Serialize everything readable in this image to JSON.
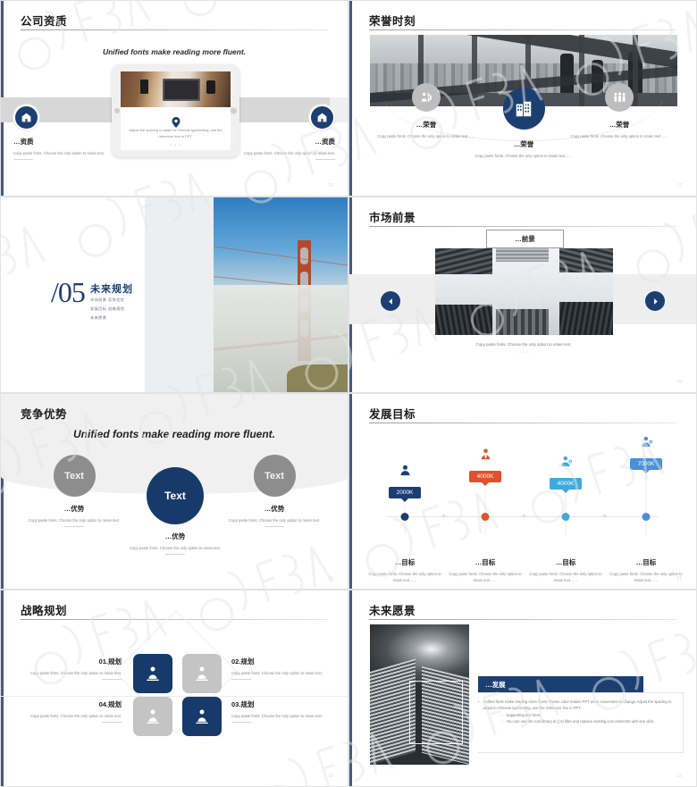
{
  "common": {
    "copy_line": "Copy paste fonts. Choose the only option to retain text.",
    "copy_line_dots": "Copy paste fonts. Choose the only option to retain text……",
    "dots_prefix": "…",
    "ellipsis": "……"
  },
  "slides": [
    {
      "id": "company-qualification",
      "title": "公司资质",
      "page": "15",
      "script": "Unified fonts make reading more fluent.",
      "tablet": {
        "caption": "Adjust the spacing to adapt to Chinese typesetting, use the reference line in PPT.",
        "dots": "• • •",
        "pin_icon": "location-pin-icon",
        "photo_alt": "desk-laptop-photo"
      },
      "columns": [
        {
          "icon": "home-shield-icon",
          "label": "…资质",
          "body": "Copy paste fonts. Choose the only option to retain text."
        },
        {
          "icon": "home-shield-icon",
          "label": "…资质",
          "body": "Copy paste fonts. Choose the only option to retain text."
        }
      ]
    },
    {
      "id": "honor-moment",
      "title": "荣誉时刻",
      "page": "17",
      "hero_alt": "people-looking-at-city-skyline-photo",
      "nodes": [
        {
          "icon": "person-award-icon",
          "label": "…荣誉",
          "body": "Copy paste fonts. Choose the only option to retain text……"
        },
        {
          "icon": "building-icon",
          "label": "…荣誉",
          "body": "Copy paste fonts. Choose the only option to retain text……"
        },
        {
          "icon": "people-group-icon",
          "label": "…荣誉",
          "body": "Copy paste fonts. Choose the only option to retain text……"
        }
      ]
    },
    {
      "id": "future-plan-divider",
      "number": "/05",
      "title": "未来规划",
      "sublines": [
        "市场前景   竞争优势",
        "发展目标   战略规划",
        "未来愿景"
      ],
      "image_alt": "golden-gate-bridge-photo"
    },
    {
      "id": "market-prospects",
      "title": "市场前景",
      "page": "19",
      "caption_box": "…前景",
      "image_alt": "skyscraper-looking-up-photo",
      "prev_icon": "arrow-left-icon",
      "next_icon": "arrow-right-icon",
      "body": "Copy paste fonts. Choose the only option to retain text.",
      "dots": "- - - -"
    },
    {
      "id": "competitive-advantage",
      "title": "竞争优势",
      "page": "20",
      "script": "Unified fonts make reading more fluent.",
      "nodes": [
        {
          "circle_text": "Text",
          "label": "…优势",
          "body": "Copy paste fonts. Choose the only option to retain text."
        },
        {
          "circle_text": "Text",
          "label": "…优势",
          "body": "Copy paste fonts. Choose the only option to retain text."
        },
        {
          "circle_text": "Text",
          "label": "…优势",
          "body": "Copy paste fonts. Choose the only option to retain text."
        }
      ]
    },
    {
      "id": "development-goals",
      "title": "发展目标",
      "page": "21",
      "milestones": [
        {
          "value": "2000K",
          "color": "#1b3f72",
          "icon": "person-dark-icon",
          "label": "…目标",
          "body": "Copy paste fonts. Choose the only option to retain text……"
        },
        {
          "value": "4000K",
          "color": "#e1512b",
          "icon": "person-tie-icon",
          "label": "…目标",
          "body": "Copy paste fonts. Choose the only option to retain text……"
        },
        {
          "value": "4000K",
          "color": "#3fa9dd",
          "icon": "person-cyan-icon",
          "label": "…目标",
          "body": "Copy paste fonts. Choose the only option to retain text……"
        },
        {
          "value": "7000K",
          "color": "#4a90d9",
          "icon": "person-blue-icon",
          "label": "…目标",
          "body": "Copy paste fonts. Choose the only option to retain text……"
        }
      ]
    },
    {
      "id": "strategic-planning",
      "title": "战略规划",
      "page": "22",
      "items": [
        {
          "label": "01.规划",
          "body": "Copy paste fonts. Choose the only option to retain text.",
          "tile": "blue",
          "icon": "organization-chart-icon"
        },
        {
          "label": "02.规划",
          "body": "Copy paste fonts. Choose the only option to retain text.",
          "tile": "grey",
          "icon": "organization-chart-icon"
        },
        {
          "label": "03.规划",
          "body": "Copy paste fonts. Choose the only option to retain text.",
          "tile": "blue",
          "icon": "organization-chart-icon"
        },
        {
          "label": "04.规划",
          "body": "Copy paste fonts. Choose the only option to retain text.",
          "tile": "grey",
          "icon": "organization-chart-icon"
        }
      ]
    },
    {
      "id": "future-vision",
      "title": "未来愿景",
      "page": "23",
      "image_alt": "skyscrapers-dark-sky-photo",
      "header_label": "…发展",
      "paragraph": "Unified fonts make reading more fluent.Theme color makes PPT more convenient to change.Adjust the spacing to adapt to Chinese typesetting, use the reference line in PPT.",
      "bullets": [
        "Supporting text here.",
        "You can use the icon library in  () to filter and replace existing icon elements with one click."
      ]
    }
  ],
  "colors": {
    "navy": "#1c3f72",
    "deep_navy": "#173a6b",
    "grey": "#bdbdbd",
    "orange": "#e1512b",
    "cyan": "#3fa9dd",
    "blue": "#4a90d9"
  }
}
